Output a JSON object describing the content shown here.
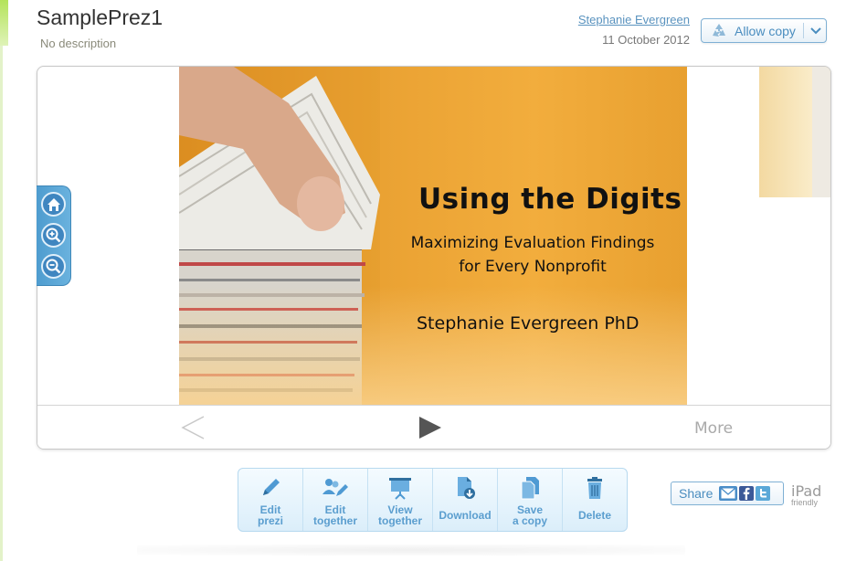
{
  "header": {
    "title": "SamplePrez1",
    "description": "No description",
    "author": "Stephanie Evergreen",
    "date": "11 October 2012",
    "allow_copy_label": "Allow copy"
  },
  "slide": {
    "title": "Using the Digits",
    "subtitle": "Maximizing Evaluation Findings for Every Nonprofit",
    "author": "Stephanie Evergreen PhD"
  },
  "navigation": {
    "more_label": "More"
  },
  "toolbar": {
    "items": [
      {
        "label": "Edit\nprezi",
        "icon": "pencil-icon"
      },
      {
        "label": "Edit\ntogether",
        "icon": "people-edit-icon"
      },
      {
        "label": "View\ntogether",
        "icon": "projector-icon"
      },
      {
        "label": "Download",
        "icon": "download-icon"
      },
      {
        "label": "Save\na copy",
        "icon": "copy-icon"
      },
      {
        "label": "Delete",
        "icon": "trash-icon"
      }
    ]
  },
  "share": {
    "label": "Share",
    "ipad_label": "iPad",
    "ipad_sub": "friendly"
  },
  "colors": {
    "accent_blue": "#5b9ecf",
    "link_blue": "#5a93bf",
    "slide_orange": "#eaa233"
  }
}
